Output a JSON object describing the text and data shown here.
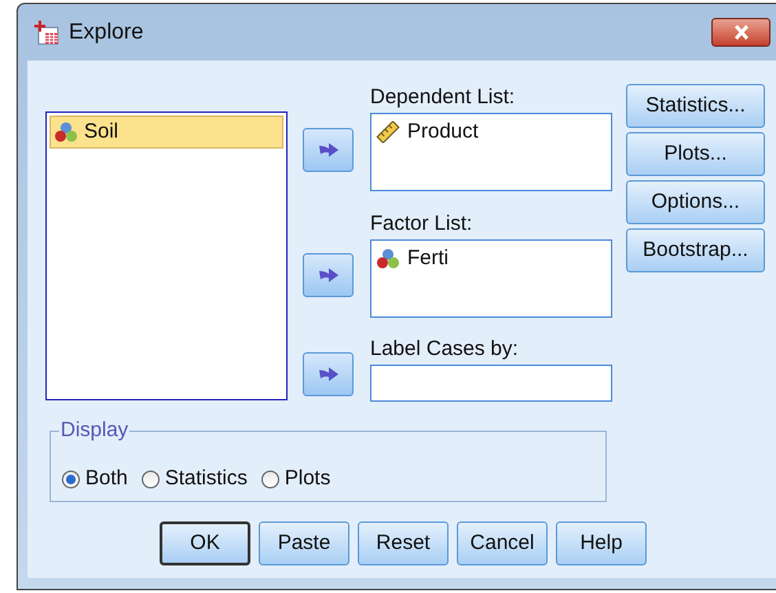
{
  "window": {
    "title": "Explore"
  },
  "variables": [
    {
      "name": "Soil",
      "kind": "nominal",
      "selected": true
    }
  ],
  "targets": [
    {
      "label": "Dependent List:",
      "items": [
        {
          "name": "Product",
          "kind": "scale"
        }
      ]
    },
    {
      "label": "Factor List:",
      "items": [
        {
          "name": "Ferti",
          "kind": "nominal"
        }
      ]
    },
    {
      "label": "Label Cases by:"
    }
  ],
  "side_buttons": [
    "Statistics...",
    "Plots...",
    "Options...",
    "Bootstrap..."
  ],
  "display": {
    "title": "Display",
    "options": [
      {
        "label": "Both",
        "selected": true
      },
      {
        "label": "Statistics",
        "selected": false
      },
      {
        "label": "Plots",
        "selected": false
      }
    ]
  },
  "buttons": [
    {
      "label": "OK",
      "default": true
    },
    {
      "label": "Paste",
      "default": false
    },
    {
      "label": "Reset",
      "default": false
    },
    {
      "label": "Cancel",
      "default": false
    },
    {
      "label": "Help",
      "default": false
    }
  ]
}
